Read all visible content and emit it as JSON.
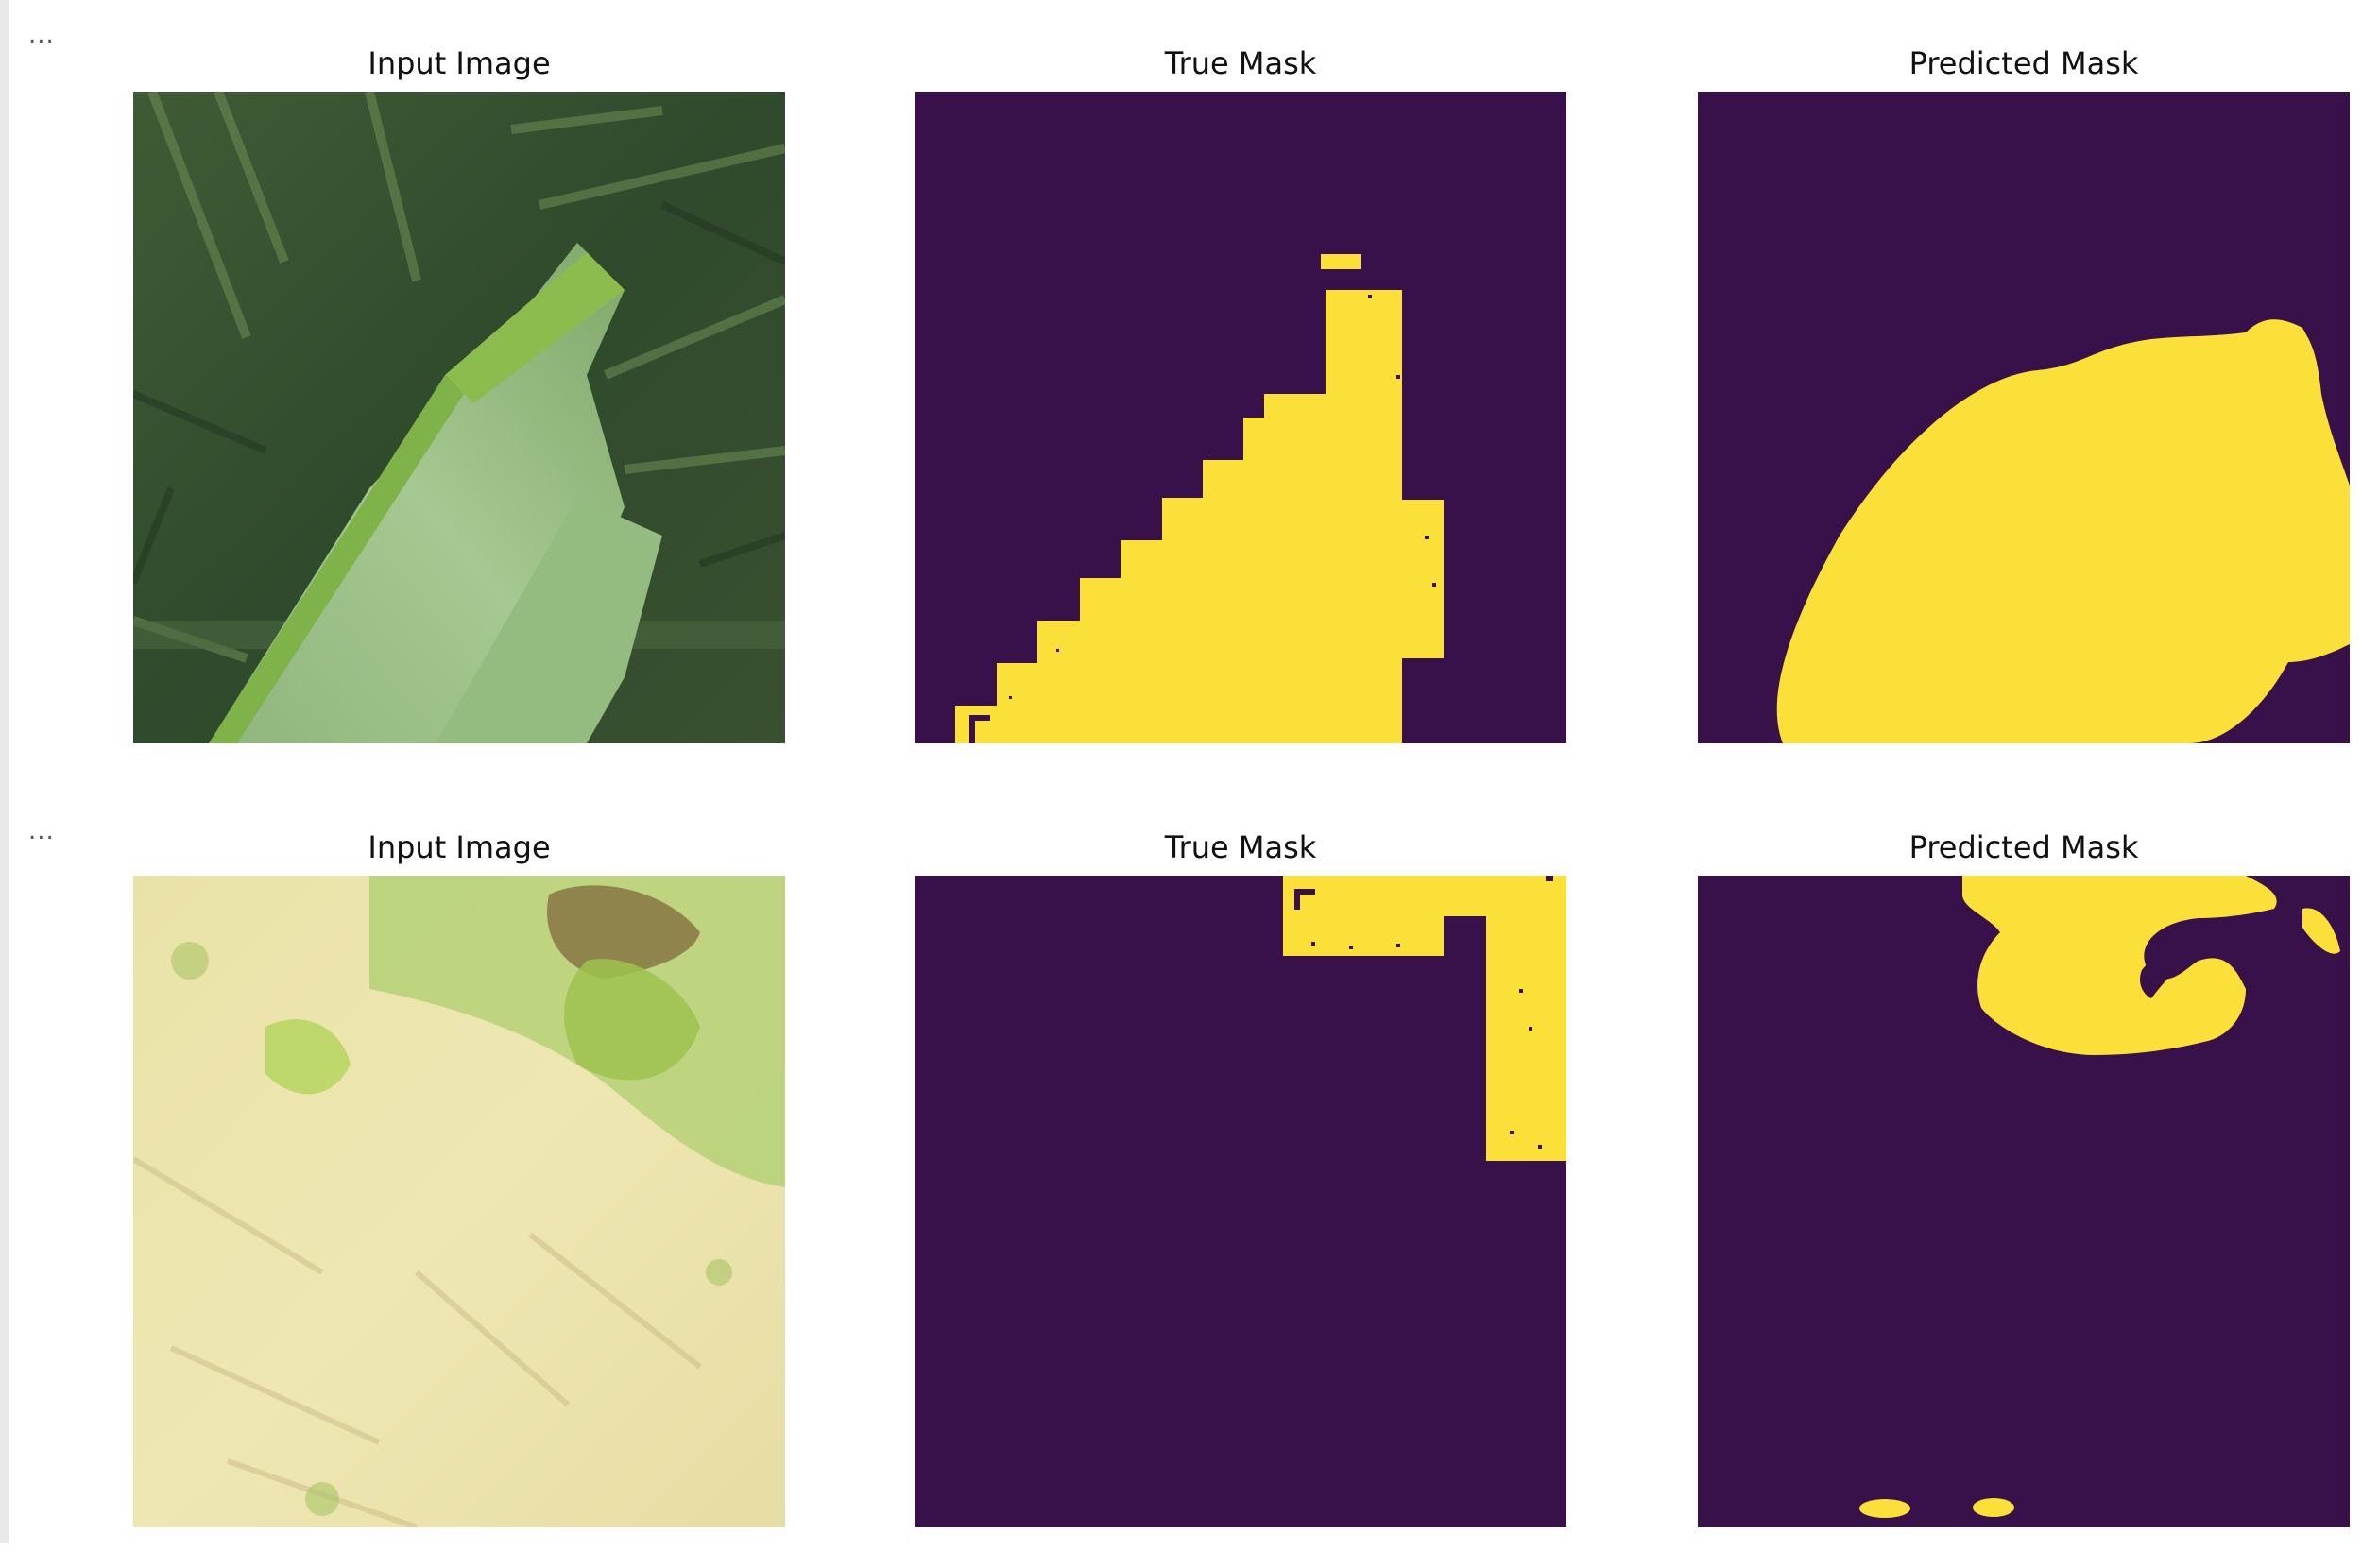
{
  "ellipsis": "...",
  "rows": [
    {
      "panels": [
        {
          "title": "Input Image"
        },
        {
          "title": "True Mask"
        },
        {
          "title": "Predicted Mask"
        }
      ]
    },
    {
      "panels": [
        {
          "title": "Input Image"
        },
        {
          "title": "True Mask"
        },
        {
          "title": "Predicted Mask"
        }
      ]
    }
  ],
  "colors": {
    "mask_background": "#38104a",
    "mask_foreground": "#fbe03a",
    "gutter": "#e9e9e9"
  }
}
